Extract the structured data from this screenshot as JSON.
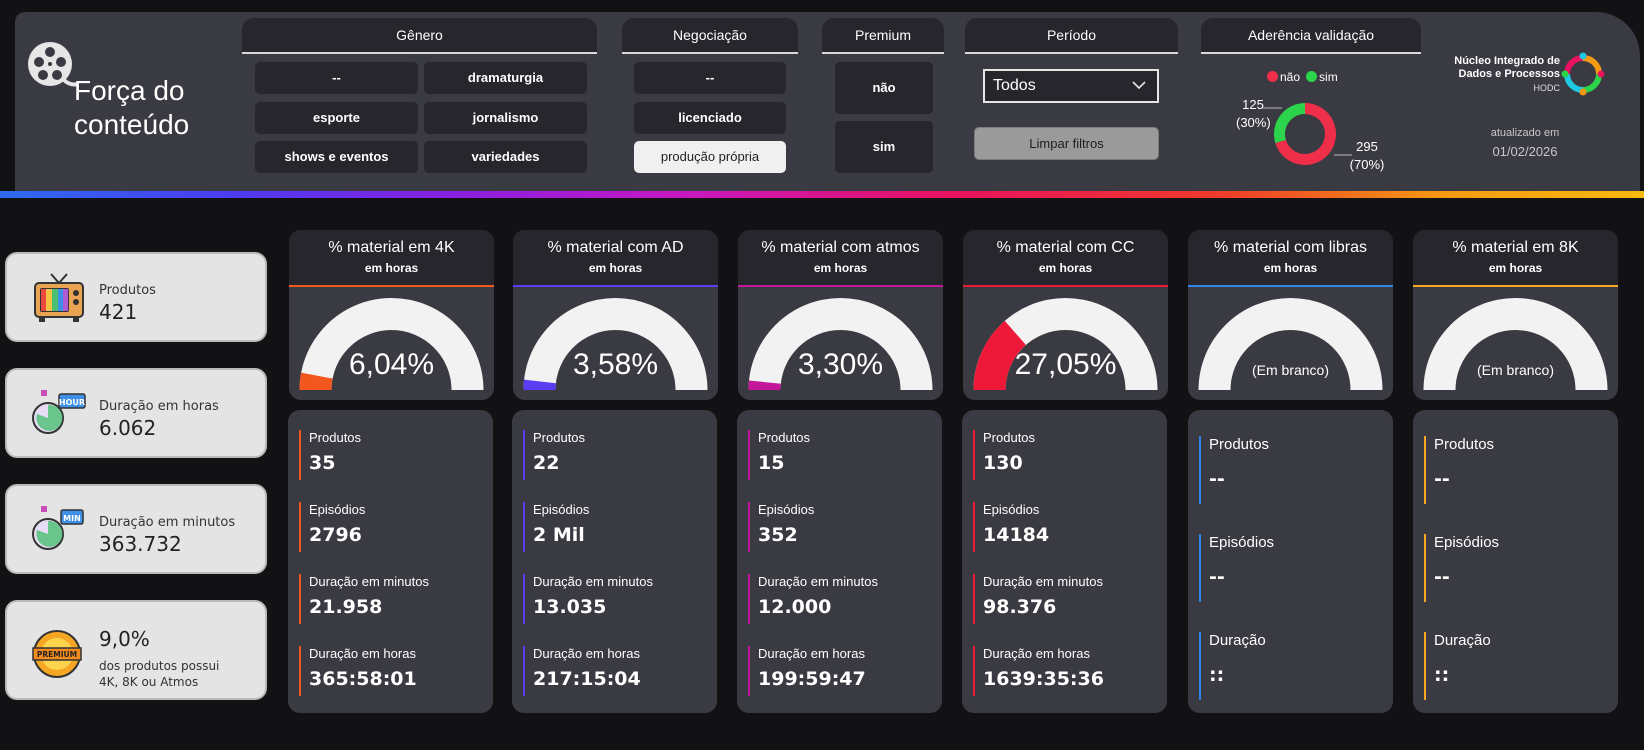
{
  "app": {
    "title": "Força do conteúdo"
  },
  "filters": {
    "genero": {
      "title": "Gênero",
      "options": [
        "--",
        "dramaturgia",
        "esporte",
        "jornalismo",
        "shows e eventos",
        "variedades"
      ]
    },
    "negociacao": {
      "title": "Negociação",
      "options": [
        "--",
        "licenciado",
        "produção própria"
      ],
      "selected": "produção própria"
    },
    "premium": {
      "title": "Premium",
      "options": [
        "não",
        "sim"
      ]
    },
    "periodo": {
      "title": "Período",
      "value": "Todos",
      "clear_label": "Limpar filtros"
    },
    "aderencia": {
      "title": "Aderência validação",
      "legend": [
        {
          "label": "não",
          "color": "#ef2f49"
        },
        {
          "label": "sim",
          "color": "#2bd44a"
        }
      ],
      "nao": {
        "count": "295",
        "pct": "(70%)",
        "value": 295
      },
      "sim": {
        "count": "125",
        "pct": "(30%)",
        "value": 125
      }
    }
  },
  "org": {
    "name_line1": "Núcleo Integrado de",
    "name_line2": "Dados e Processos",
    "abbr": "HODC",
    "updated_label": "atualizado em",
    "updated_date": "01/02/2026"
  },
  "kpis": [
    {
      "label": "Produtos",
      "value": "421",
      "icon": "tv-icon"
    },
    {
      "label": "Duração em horas",
      "value": "6.062",
      "icon": "stopwatch-hour-icon",
      "badge": "HOUR"
    },
    {
      "label": "Duração em minutos",
      "value": "363.732",
      "icon": "stopwatch-min-icon",
      "badge": "MIN"
    },
    {
      "label": "9,0%",
      "value": "dos produtos possui",
      "value2": "4K, 8K ou Atmos",
      "icon": "premium-badge-icon",
      "badge": "PREMIUM"
    }
  ],
  "metrics": [
    {
      "title": "% material em 4K",
      "subtitle": "em horas",
      "gauge_label": "6,04%",
      "percent": 6.04,
      "color": "#f2581d",
      "stats": [
        {
          "label": "Produtos",
          "value": "35"
        },
        {
          "label": "Episódios",
          "value": "2796"
        },
        {
          "label": "Duração em minutos",
          "value": "21.958"
        },
        {
          "label": "Duração em horas",
          "value": "365:58:01"
        }
      ]
    },
    {
      "title": "% material com AD",
      "subtitle": "em horas",
      "gauge_label": "3,58%",
      "percent": 3.58,
      "color": "#5a3cf2",
      "stats": [
        {
          "label": "Produtos",
          "value": "22"
        },
        {
          "label": "Episódios",
          "value": "2 Mil"
        },
        {
          "label": "Duração em minutos",
          "value": "13.035"
        },
        {
          "label": "Duração em horas",
          "value": "217:15:04"
        }
      ]
    },
    {
      "title": "% material com atmos",
      "subtitle": "em horas",
      "gauge_label": "3,30%",
      "percent": 3.3,
      "color": "#c4169a",
      "stats": [
        {
          "label": "Produtos",
          "value": "15"
        },
        {
          "label": "Episódios",
          "value": "352"
        },
        {
          "label": "Duração em minutos",
          "value": "12.000"
        },
        {
          "label": "Duração em horas",
          "value": "199:59:47"
        }
      ]
    },
    {
      "title": "% material com CC",
      "subtitle": "em horas",
      "gauge_label": "27,05%",
      "percent": 27.05,
      "color": "#ee1938",
      "stats": [
        {
          "label": "Produtos",
          "value": "130"
        },
        {
          "label": "Episódios",
          "value": "14184"
        },
        {
          "label": "Duração em minutos",
          "value": "98.376"
        },
        {
          "label": "Duração em horas",
          "value": "1639:35:36"
        }
      ]
    },
    {
      "title": "% material com libras",
      "subtitle": "em horas",
      "gauge_label": "(Em branco)",
      "percent": 0,
      "color": "#2f85e8",
      "stats": [
        {
          "label": "Produtos",
          "value": "--"
        },
        {
          "label": "Episódios",
          "value": "--"
        },
        {
          "label": "Duração",
          "value": "::"
        }
      ]
    },
    {
      "title": "% material em 8K",
      "subtitle": "em horas",
      "gauge_label": "(Em branco)",
      "percent": 0,
      "color": "#f5a623",
      "stats": [
        {
          "label": "Produtos",
          "value": "--"
        },
        {
          "label": "Episódios",
          "value": "--"
        },
        {
          "label": "Duração",
          "value": "::"
        }
      ]
    }
  ]
}
